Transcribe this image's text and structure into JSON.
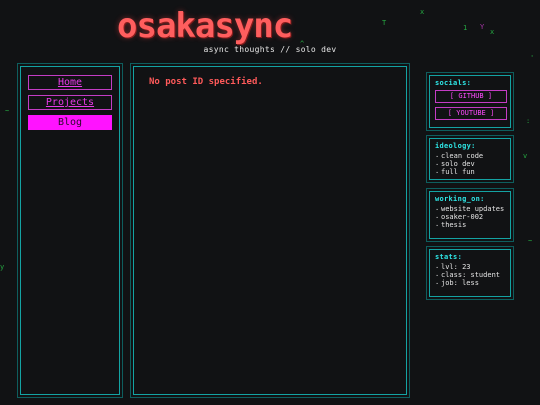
{
  "header": {
    "logo": "osakasync",
    "tagline": "async thoughts // solo dev"
  },
  "nav": {
    "items": [
      {
        "label": "Home"
      },
      {
        "label": "Projects"
      },
      {
        "label": "Blog"
      }
    ],
    "active": "Blog"
  },
  "main": {
    "message": "No post ID specified."
  },
  "sidebar": {
    "socials": {
      "title": "socials:",
      "links": [
        "[ GITHUB ]",
        "[ YOUTUBE ]"
      ]
    },
    "ideology": {
      "title": "ideology:",
      "items": [
        "clean code",
        "solo dev",
        "full fun"
      ]
    },
    "working_on": {
      "title": "working_on:",
      "items": [
        "website updates",
        "osaker-002",
        "thesis"
      ]
    },
    "stats": {
      "title": "stats:",
      "items": [
        "lvl: 23",
        "class: student",
        "job: less"
      ]
    }
  },
  "colors": {
    "background": "#111214",
    "accent_cyan": "#14a3a3",
    "accent_magenta": "#ff13ff",
    "logo_red": "#ff5e5e"
  }
}
